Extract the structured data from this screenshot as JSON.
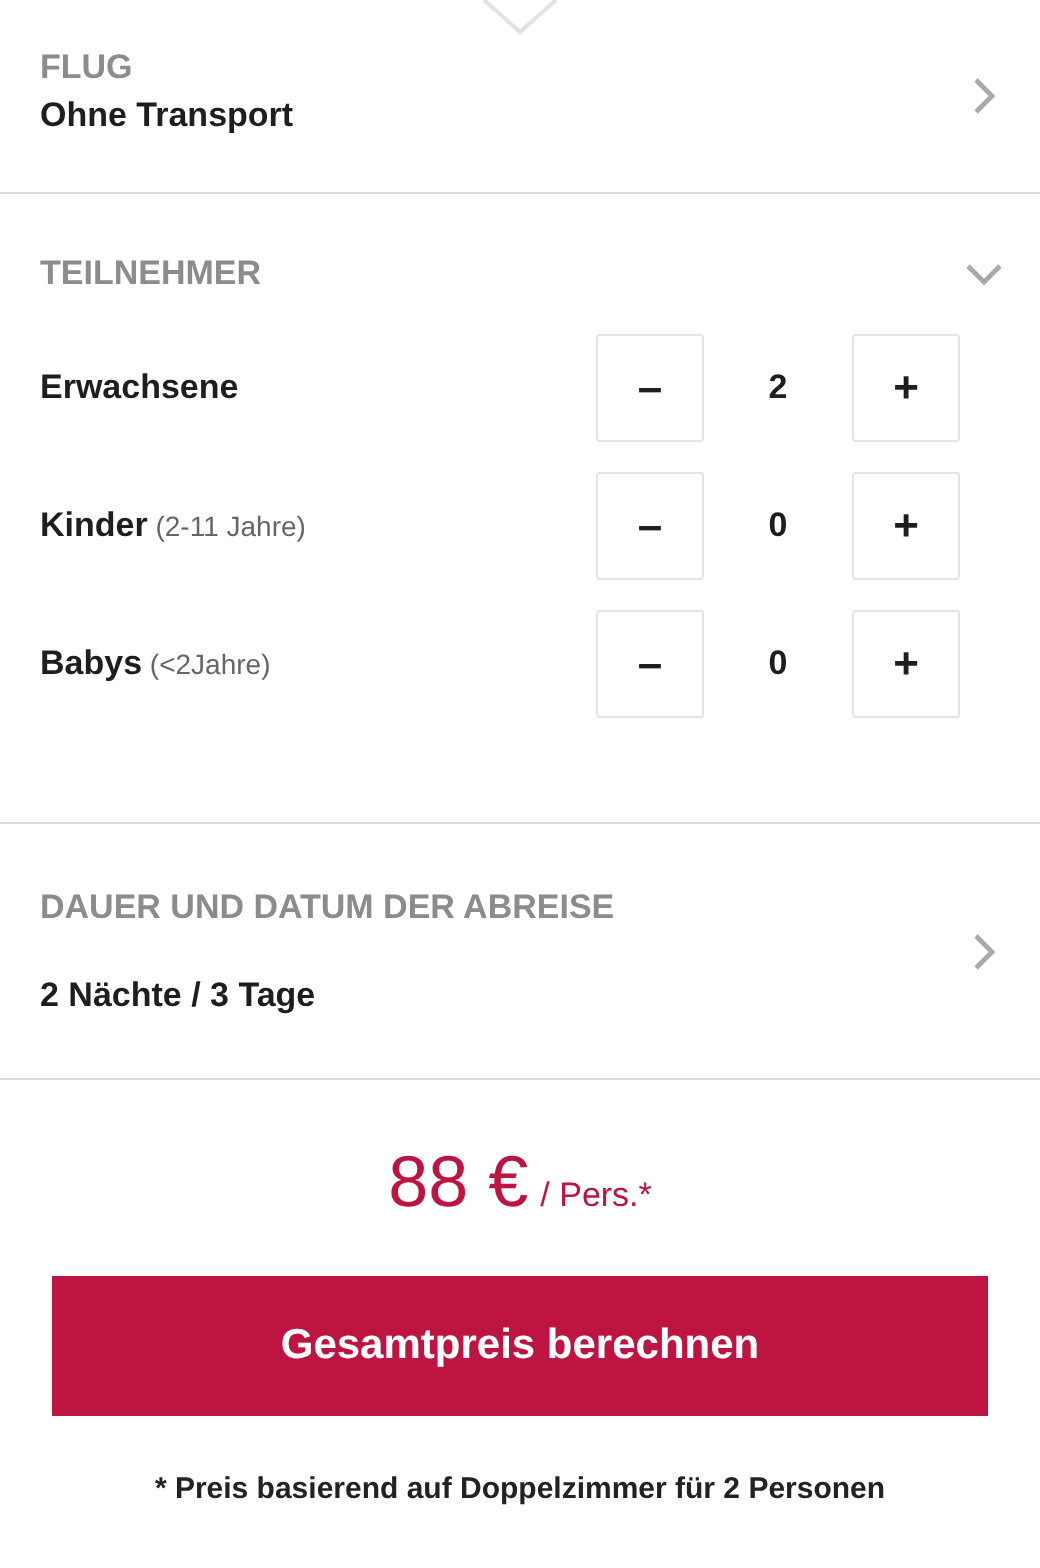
{
  "flight": {
    "heading": "FLUG",
    "value": "Ohne Transport",
    "expanded": false
  },
  "participants": {
    "heading": "TEILNEHMER",
    "expanded": true,
    "rows": [
      {
        "label": "Erwachsene",
        "hint": "",
        "decrement": "–",
        "count": "2",
        "increment": "+"
      },
      {
        "label": "Kinder",
        "hint": "(2-11 Jahre)",
        "decrement": "–",
        "count": "0",
        "increment": "+"
      },
      {
        "label": "Babys",
        "hint": "(<2Jahre)",
        "decrement": "–",
        "count": "0",
        "increment": "+"
      }
    ]
  },
  "duration": {
    "heading": "DAUER UND DATUM DER ABREISE",
    "value": "2 Nächte / 3 Tage",
    "expanded": false
  },
  "price": {
    "amount": "88 €",
    "unit": "/ Pers.*"
  },
  "submit_button": "Gesamtpreis berechnen",
  "footnote": "* Preis basierend auf Doppelzimmer für 2 Personen"
}
